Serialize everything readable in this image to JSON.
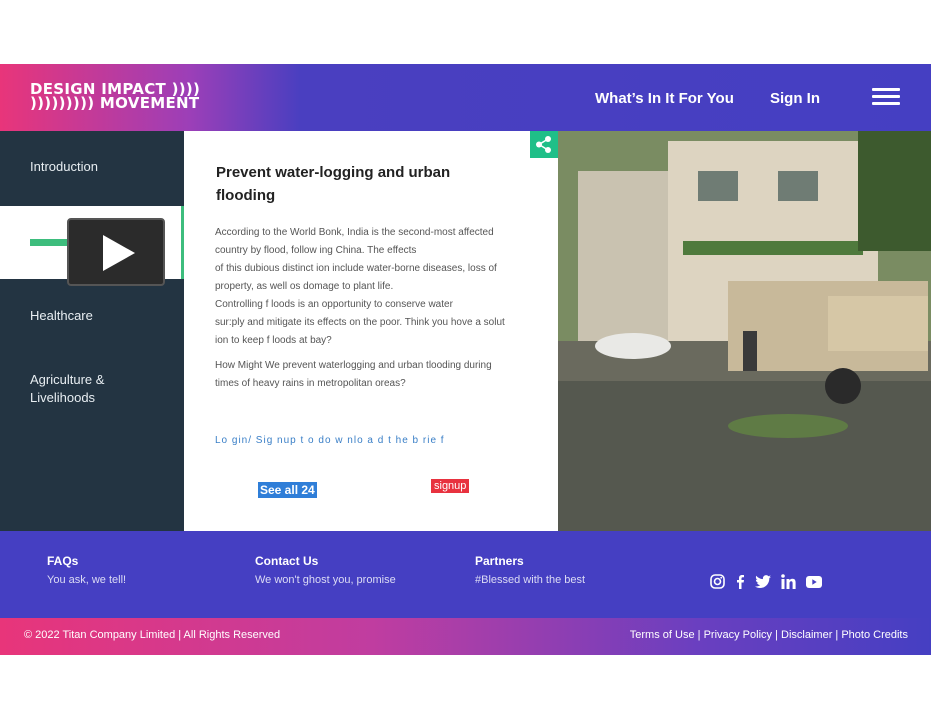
{
  "header": {
    "logo_line1": "DESIGN IMPACT ))))",
    "logo_line2": "))))))))) MOVEMENT",
    "nav_whats_in_it": "What’s In It For You",
    "nav_sign_in": "Sign In"
  },
  "sidebar": {
    "items": [
      {
        "label": "Introduction"
      },
      {
        "label": "Healthcare"
      },
      {
        "label": "Agriculture &"
      },
      {
        "label": "Livelihoods"
      }
    ]
  },
  "content": {
    "title_line1": "Prevent water-logging  and  urban",
    "title_line2": "flooding",
    "paragraph1": [
      "According to the World Bonk, India  is the second-most affected",
      "country by flood, follow ing China. The effects",
      "of this dubious distinct ion  include water-borne diseases, loss of",
      "property, as well os domage to plant life.",
      "Controlling  f loods is an opportunity to conserve water",
      "sur:ply and mitigate  its effects on the poor. Think you hove a solut",
      "ion  to keep f loods at bay?"
    ],
    "paragraph2": [
      "How  Might We prevent waterlogging and urban tlooding during",
      "times of  heavy rains in metropolitan oreas?"
    ],
    "login_link": "Lo gin/ Sig nup  t o  do w nlo a d t he b rie f",
    "see_all": "See all 24",
    "signup": "signup"
  },
  "footer": {
    "faqs_title": "FAQs",
    "faqs_sub": "You ask, we tell!",
    "contact_title": "Contact Us",
    "contact_sub": "We won't ghost you, promise",
    "partners_title": "Partners",
    "partners_sub": "#Blessed with the best",
    "social_icons": [
      "instagram-icon",
      "facebook-icon",
      "twitter-icon",
      "linkedin-icon",
      "youtube-icon"
    ]
  },
  "bottom_bar": {
    "copyright": "© 2022 Titan Company Limited | All Rights Reserved",
    "terms": "Terms of Use",
    "privacy": "Privacy Policy",
    "disclaimer": "Disclaimer",
    "photo_credits": "Photo Credits",
    "separator": " | "
  },
  "colors": {
    "brand_purple": "#453fc2",
    "brand_pink": "#e8357a",
    "sidebar_dark": "#233442",
    "accent_green": "#3dbd7d",
    "signup_red": "#e8323f",
    "see_all_blue": "#2f7ed8"
  }
}
